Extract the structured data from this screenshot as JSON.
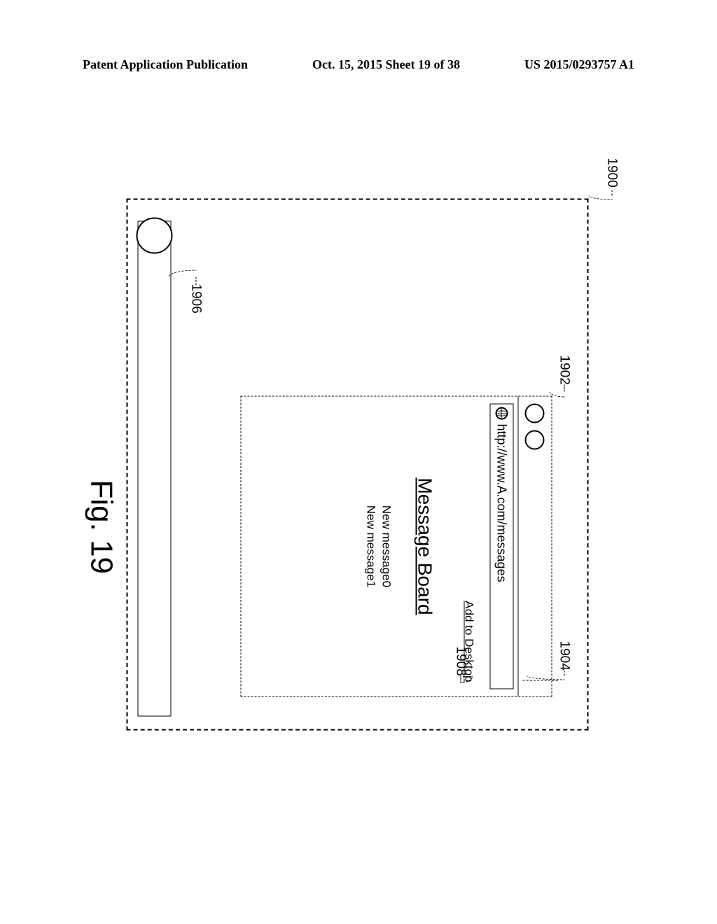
{
  "header": {
    "left": "Patent Application Publication",
    "center": "Oct. 15, 2015  Sheet 19 of 38",
    "right": "US 2015/0293757 A1"
  },
  "figure": {
    "url": "http://www.A.com/messages",
    "add_desktop": "Add to Desktop",
    "heading": "Message Board",
    "msg0": "New message0",
    "msg1": "New message1",
    "caption": "Fig. 19"
  },
  "refs": {
    "r1900": "1900",
    "r1902": "1902",
    "r1904": "1904",
    "r1906": "1906",
    "r1908": "1908"
  }
}
